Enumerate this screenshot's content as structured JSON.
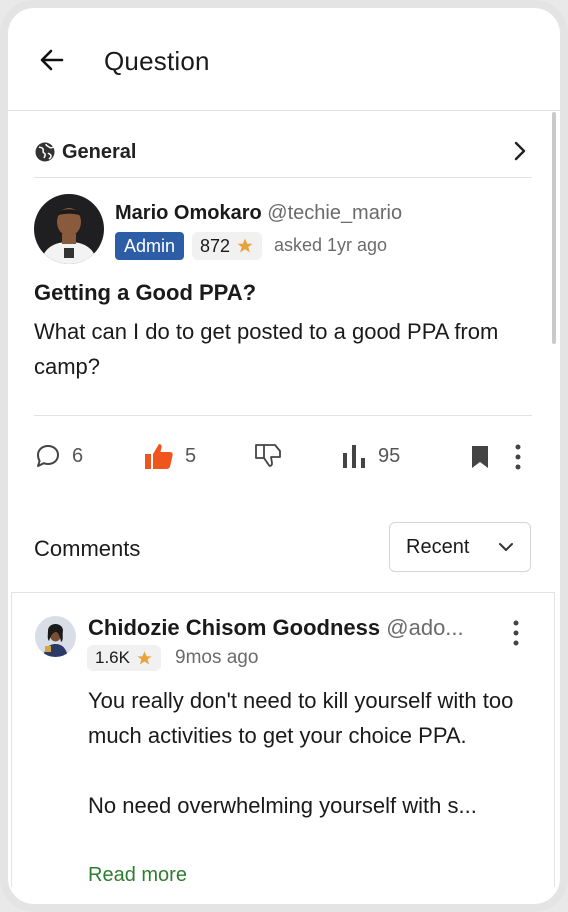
{
  "header": {
    "title": "Question"
  },
  "question": {
    "category": "General",
    "author": {
      "name": "Mario Omokaro",
      "handle": "@techie_mario",
      "role": "Admin",
      "points": "872",
      "asked": "asked 1yr ago"
    },
    "title": "Getting a Good PPA?",
    "body": "What can I do to get posted to a good PPA from camp?",
    "stats": {
      "comments": "6",
      "likes": "5",
      "views": "95"
    }
  },
  "comments_section": {
    "heading": "Comments",
    "sort": {
      "selected": "Recent"
    }
  },
  "comment": {
    "name": "Chidozie Chisom Goodness",
    "handle": "@ado...",
    "points": "1.6K",
    "time": "9mos ago",
    "para1": "You really don't need to kill yourself with too much activities to get your choice PPA.",
    "para2": "No need overwhelming yourself with s...",
    "read_more": "Read more"
  },
  "colors": {
    "admin_badge": "#2d5da6",
    "star": "#e8a33d",
    "like_active": "#f0551e",
    "read_more": "#2e7d32"
  }
}
